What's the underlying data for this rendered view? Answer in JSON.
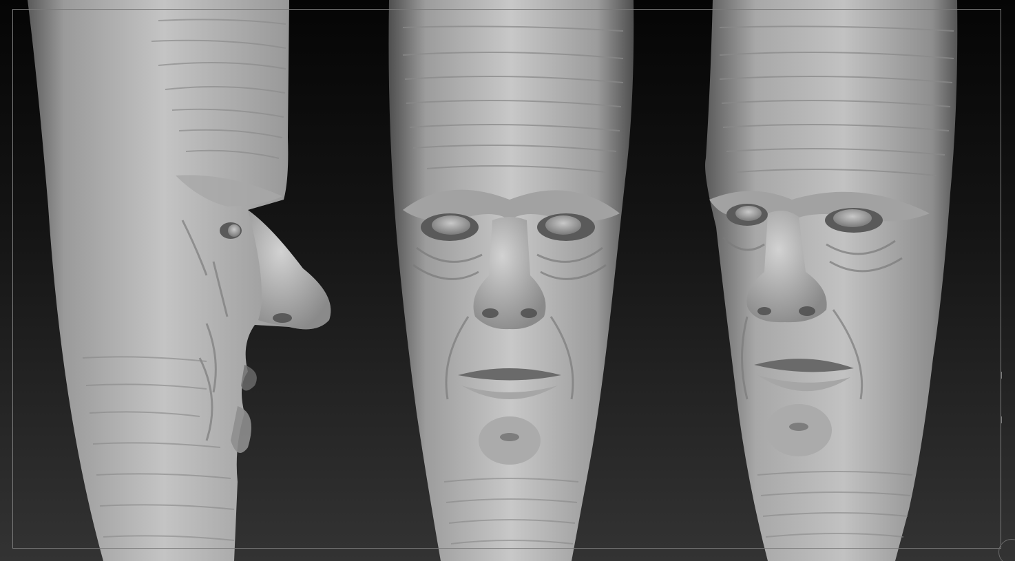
{
  "canvas": {
    "background_top": "#050505",
    "background_bottom": "#333333",
    "frame_color": "#7a7a7a",
    "clay_color": "#b4b4b4"
  },
  "views": [
    {
      "id": "side",
      "icon": "sculpt-head-side-profile-icon"
    },
    {
      "id": "front",
      "icon": "sculpt-head-front-icon"
    },
    {
      "id": "three-quarter",
      "icon": "sculpt-head-three-quarter-icon"
    }
  ]
}
